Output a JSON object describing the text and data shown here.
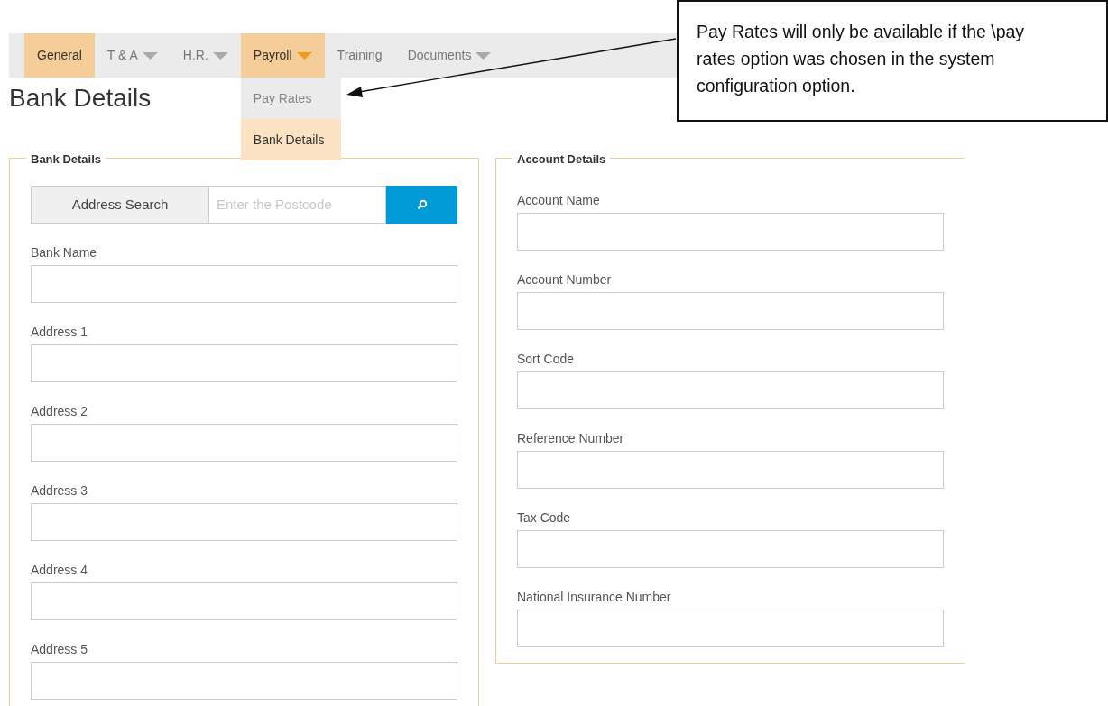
{
  "nav": {
    "tabs": [
      {
        "label": "General",
        "selected": true,
        "caret": false
      },
      {
        "label": "T & A",
        "selected": false,
        "caret": true
      },
      {
        "label": "H.R.",
        "selected": false,
        "caret": true
      },
      {
        "label": "Payroll",
        "selected": true,
        "caret": true,
        "menu": [
          {
            "label": "Pay Rates",
            "selected": false
          },
          {
            "label": "Bank Details",
            "selected": true
          }
        ]
      },
      {
        "label": "Training",
        "selected": false,
        "caret": false
      },
      {
        "label": "Documents",
        "selected": false,
        "caret": true
      }
    ]
  },
  "page_title": "Bank Details",
  "bank_details": {
    "legend": "Bank Details",
    "address_search": {
      "label": "Address Search",
      "placeholder": "Enter the Postcode"
    },
    "fields": [
      "Bank Name",
      "Address 1",
      "Address 2",
      "Address 3",
      "Address 4",
      "Address 5"
    ]
  },
  "account_details": {
    "legend": "Account Details",
    "fields": [
      "Account Name",
      "Account Number",
      "Sort Code",
      "Reference Number",
      "Tax Code",
      "National Insurance Number"
    ]
  },
  "callout": {
    "text": "Pay Rates will only be available if the \\pay rates option was chosen in the system configuration option."
  }
}
